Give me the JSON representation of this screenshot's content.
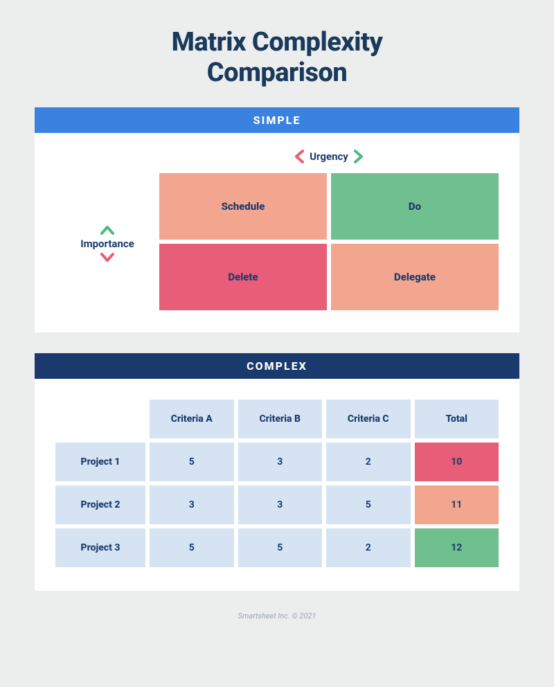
{
  "title_line1": "Matrix Complexity",
  "title_line2": "Comparison",
  "simple": {
    "header": "SIMPLE",
    "axis_vertical": "Importance",
    "axis_horizontal": "Urgency",
    "quadrants": {
      "top_left": "Schedule",
      "top_right": "Do",
      "bottom_left": "Delete",
      "bottom_right": "Delegate"
    },
    "quadrant_colors": {
      "top_left": "salmon",
      "top_right": "green",
      "bottom_left": "pink",
      "bottom_right": "salmon"
    }
  },
  "complex": {
    "header": "COMPLEX",
    "columns": [
      "Criteria A",
      "Criteria B",
      "Criteria C",
      "Total"
    ],
    "rows": [
      {
        "label": "Project 1",
        "values": [
          "5",
          "3",
          "2"
        ],
        "total": "10",
        "total_color": "pink"
      },
      {
        "label": "Project 2",
        "values": [
          "3",
          "3",
          "5"
        ],
        "total": "11",
        "total_color": "salmon"
      },
      {
        "label": "Project 3",
        "values": [
          "5",
          "5",
          "2"
        ],
        "total": "12",
        "total_color": "green"
      }
    ]
  },
  "footer": "Smartsheet Inc. © 2021",
  "colors": {
    "salmon": "#f2a58f",
    "green": "#6fbf8f",
    "pink": "#e85d77",
    "blue_light": "#d5e3f2",
    "header_simple": "#3b82e0",
    "header_complex": "#1a3a6e"
  }
}
